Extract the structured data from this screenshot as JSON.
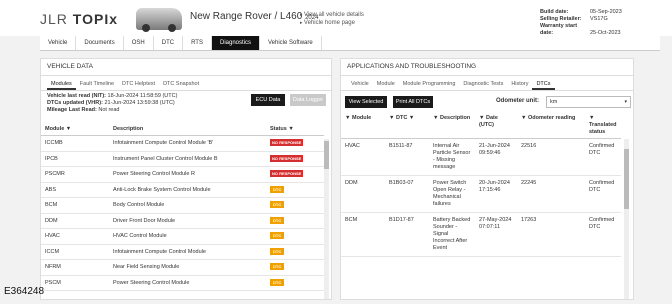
{
  "header": {
    "logo_prefix": "JLR",
    "logo_text": "TOPIx",
    "vehicle_name": "New Range Rover / L460",
    "vehicle_year": "2024",
    "links": [
      "View all vehicle details",
      "Vehicle home page"
    ],
    "build_info": [
      {
        "label": "Build date:",
        "value": "05-Sep-2023"
      },
      {
        "label": "Selling Retailer:",
        "value": "VS17G"
      },
      {
        "label": "Warranty start date:",
        "value": "25-Oct-2023"
      }
    ]
  },
  "main_tabs": [
    "Vehicle",
    "Documents",
    "OSH",
    "DTC",
    "RTS",
    "Diagnostics",
    "Vehicle Software"
  ],
  "left_panel": {
    "title": "VEHICLE DATA",
    "tabs": [
      "Modules",
      "Fault Timeline",
      "DTC Helptext",
      "DTC Snapshot"
    ],
    "meta": [
      {
        "label": "Vehicle last read (NIT):",
        "value": "18-Jun-2024 11:58:59 (UTC)"
      },
      {
        "label": "DTCs updated (VHR):",
        "value": "21-Jun-2024 13:59:38 (UTC)"
      },
      {
        "label": "Mileage Last Read:",
        "value": "Not read"
      }
    ],
    "ecu_button": "ECU Data",
    "logger_button": "Data Logger",
    "columns": [
      "Module",
      "Description",
      "Status"
    ],
    "rows": [
      {
        "module": "ICCMB",
        "description": "Infotainment Compute Control Module 'B'",
        "status": "NO RESPONSE",
        "kind": "red"
      },
      {
        "module": "IPCB",
        "description": "Instrument Panel Cluster Control Module B",
        "status": "NO RESPONSE",
        "kind": "red"
      },
      {
        "module": "PSCMR",
        "description": "Power Steering Control Module R",
        "status": "NO RESPONSE",
        "kind": "red"
      },
      {
        "module": "ABS",
        "description": "Anti-Lock Brake System Control Module",
        "status": "DTC",
        "kind": "orange"
      },
      {
        "module": "BCM",
        "description": "Body Control Module",
        "status": "DTC",
        "kind": "orange"
      },
      {
        "module": "DDM",
        "description": "Driver Front Door Module",
        "status": "DTC",
        "kind": "orange"
      },
      {
        "module": "HVAC",
        "description": "HVAC Control Module",
        "status": "DTC",
        "kind": "orange"
      },
      {
        "module": "ICCM",
        "description": "Infotainment Compute Control Module",
        "status": "DTC",
        "kind": "orange"
      },
      {
        "module": "NFRM",
        "description": "Near Field Sensing Module",
        "status": "DTC",
        "kind": "orange"
      },
      {
        "module": "PSCM",
        "description": "Power Steering Control Module",
        "status": "DTC",
        "kind": "orange"
      }
    ]
  },
  "right_panel": {
    "title": "APPLICATIONS AND TROUBLESHOOTING",
    "tabs": [
      "Vehicle",
      "Module",
      "Module Programming",
      "Diagnostic Tests",
      "History",
      "DTCs"
    ],
    "view_selected": "View Selected",
    "print_all": "Print All DTCs",
    "odometer_label": "Odometer unit:",
    "odometer_value": "km",
    "columns": [
      "Module",
      "DTC",
      "Description",
      "Date (UTC)",
      "Odometer reading",
      "Translated status"
    ],
    "rows": [
      {
        "module": "HVAC",
        "dtc": "B1511-87",
        "description": "Internal Air Particle Sensor - Missing message",
        "date": "21-Jun-2024 09:59:46",
        "odometer": "22516",
        "status": "Confirmed DTC"
      },
      {
        "module": "DDM",
        "dtc": "B1B03-07",
        "description": "Power Switch Open Relay - Mechanical failures",
        "date": "20-Jun-2024 17:15:46",
        "odometer": "22245",
        "status": "Confirmed DTC"
      },
      {
        "module": "BCM",
        "dtc": "B1D17-87",
        "description": "Battery Backed Sounder - Signal Incorrect After Event",
        "date": "27-May-2024 07:07:11",
        "odometer": "17263",
        "status": "Confirmed DTC"
      }
    ]
  },
  "figure_ref": "E364248"
}
